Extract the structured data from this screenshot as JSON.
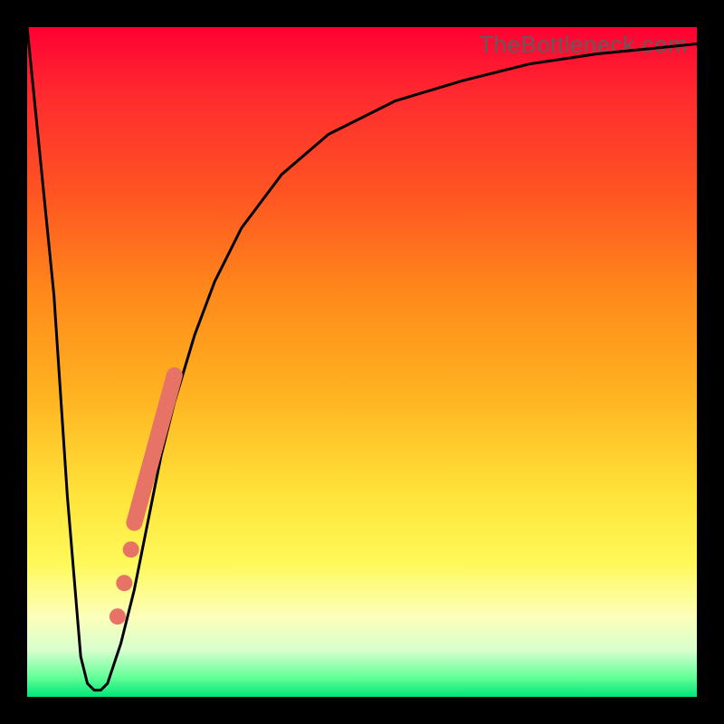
{
  "watermark": "TheBottleneck.com",
  "chart_data": {
    "type": "line",
    "title": "",
    "xlabel": "",
    "ylabel": "",
    "xlim": [
      0,
      100
    ],
    "ylim": [
      0,
      100
    ],
    "series": [
      {
        "name": "bottleneck-curve",
        "x": [
          0,
          4,
          6,
          8,
          9,
          10,
          11,
          12,
          14,
          16,
          18,
          20,
          22,
          25,
          28,
          32,
          38,
          45,
          55,
          65,
          75,
          85,
          95,
          100
        ],
        "values": [
          100,
          60,
          30,
          6,
          2,
          1,
          1,
          2,
          8,
          16,
          26,
          36,
          44,
          54,
          62,
          70,
          78,
          84,
          89,
          92,
          94.5,
          96,
          97,
          97.5
        ]
      }
    ],
    "markers": [
      {
        "name": "segment-highlight",
        "type": "thick-line",
        "x": [
          16,
          22
        ],
        "values": [
          26,
          48
        ],
        "color": "#e77366",
        "width": 18
      },
      {
        "name": "dot-1",
        "type": "dot",
        "x": 15.5,
        "value": 22,
        "color": "#e77366",
        "r": 9
      },
      {
        "name": "dot-2",
        "type": "dot",
        "x": 14.5,
        "value": 17,
        "color": "#e77366",
        "r": 9
      },
      {
        "name": "dot-3",
        "type": "dot",
        "x": 13.5,
        "value": 12,
        "color": "#e77366",
        "r": 9
      }
    ],
    "gradient_meaning": "vertical gradient from red (top, high bottleneck) to green (bottom, low bottleneck)"
  }
}
